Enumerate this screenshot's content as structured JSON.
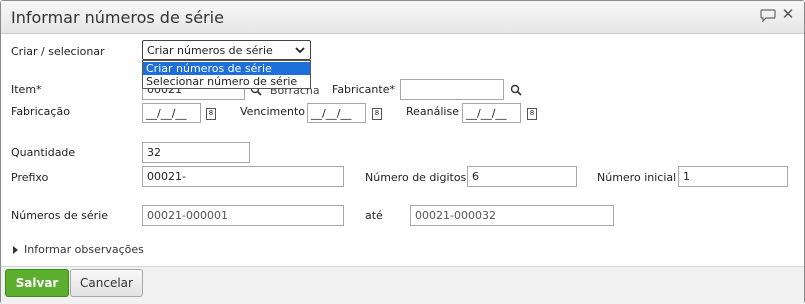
{
  "dialog": {
    "title": "Informar números de série",
    "icons": {
      "chat": "chat-bubble-icon",
      "close": "close-icon"
    }
  },
  "form": {
    "criar_label": "Criar / selecionar",
    "criar_selected": "Criar números de série",
    "criar_options": [
      "Criar números de série",
      "Selecionar número de série"
    ],
    "item_label": "Item*",
    "item_value": "00021",
    "item_desc": "Borracha",
    "fabricante_label": "Fabricante*",
    "fabricante_value": "",
    "fabricacao_label": "Fabricação",
    "fabricacao_value": "__/__/__",
    "vencimento_label": "Vencimento",
    "vencimento_value": "__/__/__",
    "reanalise_label": "Reanálise",
    "reanalise_value": "__/__/__",
    "quantidade_label": "Quantidade",
    "quantidade_value": "32",
    "prefixo_label": "Prefixo",
    "prefixo_value": "00021-",
    "num_digitos_label": "Número de digitos",
    "num_digitos_value": "6",
    "num_inicial_label": "Número inicial",
    "num_inicial_value": "1",
    "numeros_serie_label": "Números de série",
    "numeros_serie_from": "00021-000001",
    "ate_label": "até",
    "numeros_serie_to": "00021-000032",
    "observacoes_label": "Informar observações",
    "calendar_glyph": "8"
  },
  "footer": {
    "save_label": "Salvar",
    "cancel_label": "Cancelar"
  },
  "colors": {
    "save": "#5cae2e",
    "selected_option": "#1e6fd9"
  }
}
